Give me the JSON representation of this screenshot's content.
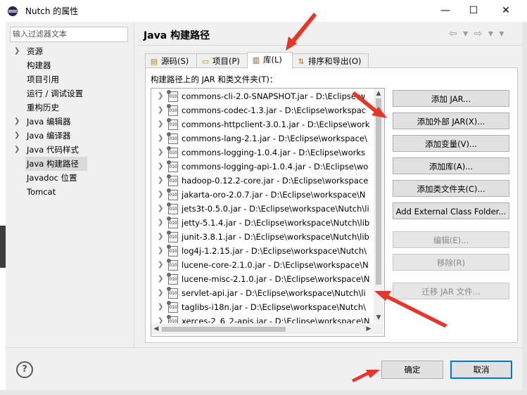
{
  "window": {
    "title": "Nutch 的属性",
    "minimize": "—",
    "maximize": "☐",
    "close": "✕"
  },
  "filter": {
    "placeholder": "输入过滤器文本"
  },
  "tree": [
    {
      "label": "资源",
      "expandable": true
    },
    {
      "label": "构建器",
      "expandable": false
    },
    {
      "label": "项目引用",
      "expandable": false
    },
    {
      "label": "运行 / 调试设置",
      "expandable": false
    },
    {
      "label": "重构历史",
      "expandable": false
    },
    {
      "label": "Java 编辑器",
      "expandable": true
    },
    {
      "label": "Java 编译器",
      "expandable": true
    },
    {
      "label": "Java 代码样式",
      "expandable": true
    },
    {
      "label": "Java 构建路径",
      "expandable": false,
      "selected": true
    },
    {
      "label": "Javadoc 位置",
      "expandable": false
    },
    {
      "label": "Tomcat",
      "expandable": false
    }
  ],
  "page": {
    "title": "Java 构建路径",
    "nav": "⇦ ▾ ⇨ ▾ ▾"
  },
  "tabs": [
    {
      "label": "源码(S)",
      "icon": "source-folder-icon",
      "glyph": "▤"
    },
    {
      "label": "项目(P)",
      "icon": "project-icon",
      "glyph": "▭"
    },
    {
      "label": "库(L)",
      "icon": "library-icon",
      "glyph": "▥",
      "active": true
    },
    {
      "label": "排序和导出(O)",
      "icon": "order-export-icon",
      "glyph": "⇅"
    }
  ],
  "list_label": "构建路径上的 JAR 和类文件夹(T)：",
  "jars": [
    "commons-cli-2.0-SNAPSHOT.jar  -  D:\\Eclipse\\w",
    "commons-codec-1.3.jar  -  D:\\Eclipse\\workspac",
    "commons-httpclient-3.0.1.jar  -  D:\\Eclipse\\work",
    "commons-lang-2.1.jar  -  D:\\Eclipse\\workspace\\",
    "commons-logging-1.0.4.jar  -  D:\\Eclipse\\works",
    "commons-logging-api-1.0.4.jar  -  D:\\Eclipse\\wo",
    "hadoop-0.12.2-core.jar  -  D:\\Eclipse\\workspace",
    "jakarta-oro-2.0.7.jar  -  D:\\Eclipse\\workspace\\N",
    "jets3t-0.5.0.jar  -  D:\\Eclipse\\workspace\\Nutch\\li",
    "jetty-5.1.4.jar  -  D:\\Eclipse\\workspace\\Nutch\\lib",
    "junit-3.8.1.jar  -  D:\\Eclipse\\workspace\\Nutch\\lib",
    "log4j-1.2.15.jar  -  D:\\Eclipse\\workspace\\Nutch\\",
    "lucene-core-2.1.0.jar  -  D:\\Eclipse\\workspace\\N",
    "lucene-misc-2.1.0.jar  -  D:\\Eclipse\\workspace\\N",
    "servlet-api.jar  -  D:\\Eclipse\\workspace\\Nutch\\li",
    "taglibs-i18n.jar  -  D:\\Eclipse\\workspace\\Nutch\\",
    "xerces-2_6_2-apis.jar  -  D:\\Eclipse\\workspace\\N"
  ],
  "buttons": [
    {
      "label": "添加 JAR...",
      "enabled": true
    },
    {
      "label": "添加外部 JAR(X)...",
      "enabled": true
    },
    {
      "label": "添加变量(V)...",
      "enabled": true
    },
    {
      "label": "添加库(A)...",
      "enabled": true
    },
    {
      "label": "添加类文件夹(C)...",
      "enabled": true
    },
    {
      "label": "Add External Class Folder...",
      "enabled": true
    },
    {
      "label": "编辑(E)...",
      "enabled": false
    },
    {
      "label": "移除(R)",
      "enabled": false
    },
    {
      "label": "迁移 JAR 文件...",
      "enabled": false
    }
  ],
  "footer": {
    "help": "?",
    "ok": "确定",
    "cancel": "取消"
  },
  "colors": {
    "annotation_arrow": "#e8352a",
    "focus_border": "#0078d7"
  }
}
